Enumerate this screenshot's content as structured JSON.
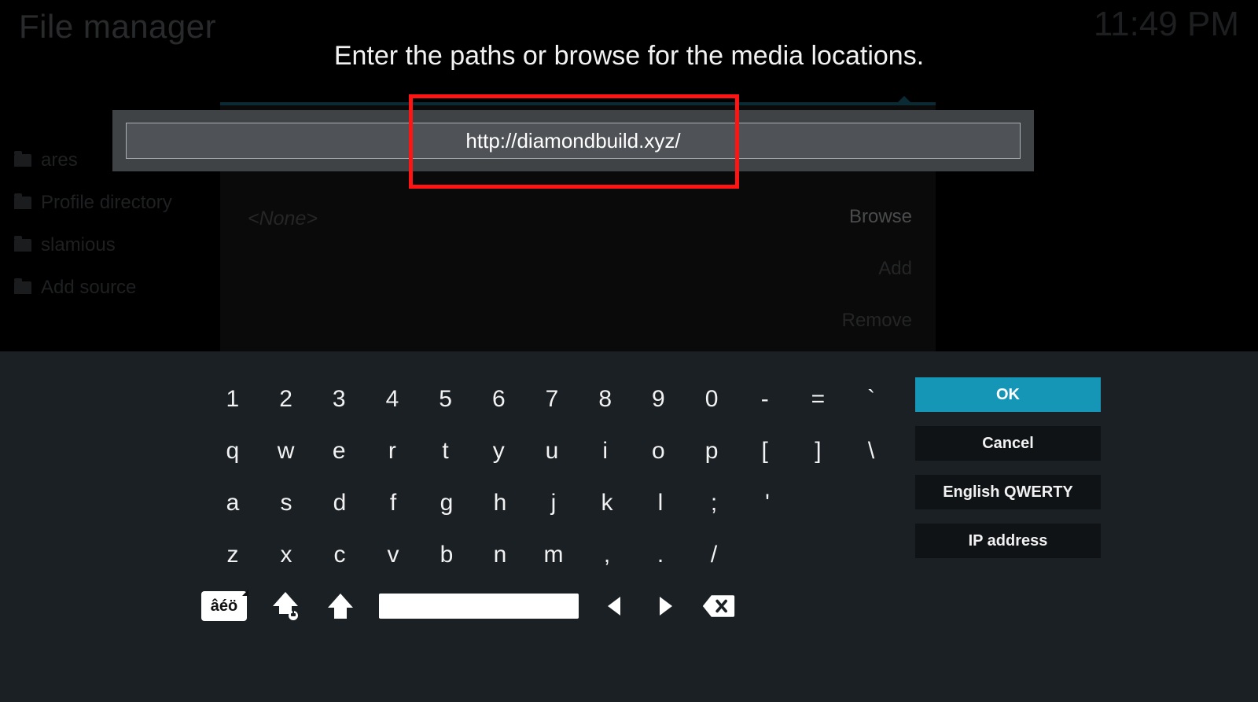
{
  "header": {
    "title": "File manager",
    "clock": "11:49 PM"
  },
  "sidebar": {
    "items": [
      {
        "icon": "folder-icon",
        "label": "ares"
      },
      {
        "icon": "folder-icon",
        "label": "Profile directory"
      },
      {
        "icon": "folder-icon",
        "label": "slamious"
      },
      {
        "icon": "folder-icon",
        "label": "Add source"
      }
    ]
  },
  "background_dialog": {
    "none_label": "<None>",
    "browse_label": "Browse",
    "add_label": "Add",
    "remove_label": "Remove"
  },
  "prompt": {
    "title": "Enter the paths or browse for the media locations.",
    "url_value": "http://diamondbuild.xyz/"
  },
  "keyboard": {
    "rows": [
      [
        "1",
        "2",
        "3",
        "4",
        "5",
        "6",
        "7",
        "8",
        "9",
        "0",
        "-",
        "=",
        "`"
      ],
      [
        "q",
        "w",
        "e",
        "r",
        "t",
        "y",
        "u",
        "i",
        "o",
        "p",
        "[",
        "]",
        "\\"
      ],
      [
        "a",
        "s",
        "d",
        "f",
        "g",
        "h",
        "j",
        "k",
        "l",
        ";",
        "'"
      ],
      [
        "z",
        "x",
        "c",
        "v",
        "b",
        "n",
        "m",
        ",",
        ".",
        "/"
      ]
    ],
    "accent_label": "âéö",
    "side_buttons": {
      "ok": "OK",
      "cancel": "Cancel",
      "layout": "English QWERTY",
      "ip": "IP address"
    }
  },
  "colors": {
    "accent": "#1596b6",
    "panel": "#1b2024",
    "highlight_box": "#ff1414"
  }
}
